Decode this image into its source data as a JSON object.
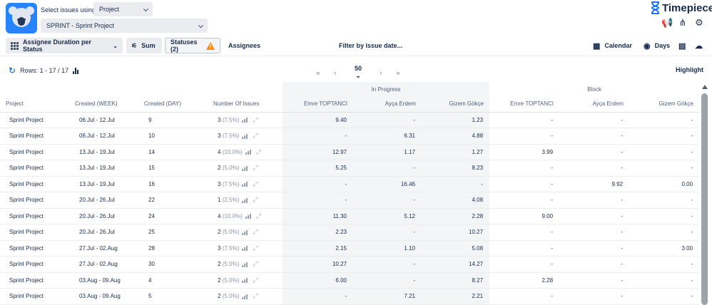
{
  "header": {
    "select_label": "Select issues using",
    "source_value": "Project",
    "project_value": "SPRINT - Sprint Project",
    "brand": "Timepiece"
  },
  "toolbar": {
    "report_type": "Assignee Duration per Status",
    "sum_label": "Sum",
    "statuses_label": "Statuses (2)",
    "assignees_label": "Assignees",
    "filter_label": "Filter by issue date...",
    "calendar_label": "Calendar",
    "days_label": "Days"
  },
  "subbar": {
    "rows_label": "Rows: 1 - 17 / 17",
    "page_size": "50",
    "highlight_label": "Highlight"
  },
  "icons": {
    "first_page": "«",
    "prev_page": "‹",
    "next_page": "›",
    "last_page": "»",
    "refresh": "↻"
  },
  "table": {
    "groups": {
      "in_progress": "In Progress",
      "block": "Block"
    },
    "columns": [
      "Project",
      "Created (WEEK)",
      "Created (DAY)",
      "Number Of Issues",
      "Emre TOPTANCI",
      "Ayça Erdem",
      "Gizem Gökçe",
      "Emre TOPTANCI",
      "Ayça Erdem",
      "Gizem Gökçe"
    ],
    "rows": [
      {
        "project": "Sprint Project",
        "week": "06.Jul - 12.Jul",
        "day": "9",
        "count": "3",
        "pct": "(7.5%)",
        "ip1": "9.40",
        "ip2": "-",
        "ip3": "1.23",
        "b1": "-",
        "b2": "-",
        "b3": "-"
      },
      {
        "project": "Sprint Project",
        "week": "06.Jul - 12.Jul",
        "day": "10",
        "count": "3",
        "pct": "(7.5%)",
        "ip1": "-",
        "ip2": "6.31",
        "ip3": "4.88",
        "b1": "-",
        "b2": "-",
        "b3": "-"
      },
      {
        "project": "Sprint Project",
        "week": "13.Jul - 19.Jul",
        "day": "14",
        "count": "4",
        "pct": "(10.0%)",
        "ip1": "12.97",
        "ip2": "1.17",
        "ip3": "1.27",
        "b1": "3.99",
        "b2": "-",
        "b3": "-"
      },
      {
        "project": "Sprint Project",
        "week": "13.Jul - 19.Jul",
        "day": "15",
        "count": "2",
        "pct": "(5.0%)",
        "ip1": "5.25",
        "ip2": "-",
        "ip3": "8.23",
        "b1": "-",
        "b2": "-",
        "b3": "-"
      },
      {
        "project": "Sprint Project",
        "week": "13.Jul - 19.Jul",
        "day": "16",
        "count": "3",
        "pct": "(7.5%)",
        "ip1": "-",
        "ip2": "16.46",
        "ip3": "-",
        "b1": "-",
        "b2": "9.92",
        "b3": "0.00"
      },
      {
        "project": "Sprint Project",
        "week": "20.Jul - 26.Jul",
        "day": "22",
        "count": "1",
        "pct": "(2.5%)",
        "ip1": "-",
        "ip2": "-",
        "ip3": "4.08",
        "b1": "-",
        "b2": "-",
        "b3": "-"
      },
      {
        "project": "Sprint Project",
        "week": "20.Jul - 26.Jul",
        "day": "24",
        "count": "4",
        "pct": "(10.0%)",
        "ip1": "11.30",
        "ip2": "5.12",
        "ip3": "2.28",
        "b1": "9.00",
        "b2": "-",
        "b3": "-"
      },
      {
        "project": "Sprint Project",
        "week": "20.Jul - 26.Jul",
        "day": "25",
        "count": "2",
        "pct": "(5.0%)",
        "ip1": "2.23",
        "ip2": "-",
        "ip3": "10.27",
        "b1": "-",
        "b2": "-",
        "b3": "-"
      },
      {
        "project": "Sprint Project",
        "week": "27.Jul - 02.Aug",
        "day": "28",
        "count": "3",
        "pct": "(7.5%)",
        "ip1": "2.15",
        "ip2": "1.10",
        "ip3": "5.08",
        "b1": "-",
        "b2": "-",
        "b3": "3.00"
      },
      {
        "project": "Sprint Project",
        "week": "27.Jul - 02.Aug",
        "day": "30",
        "count": "2",
        "pct": "(5.0%)",
        "ip1": "10.27",
        "ip2": "-",
        "ip3": "14.27",
        "b1": "-",
        "b2": "-",
        "b3": "-"
      },
      {
        "project": "Sprint Project",
        "week": "03.Aug - 09.Aug",
        "day": "4",
        "count": "2",
        "pct": "(5.0%)",
        "ip1": "6.00",
        "ip2": "-",
        "ip3": "8.27",
        "b1": "2.28",
        "b2": "-",
        "b3": "-"
      },
      {
        "project": "Sprint Project",
        "week": "03.Aug - 09.Aug",
        "day": "5",
        "count": "2",
        "pct": "(5.0%)",
        "ip1": "-",
        "ip2": "7.21",
        "ip3": "2.21",
        "b1": "-",
        "b2": "-",
        "b3": "-"
      }
    ]
  }
}
